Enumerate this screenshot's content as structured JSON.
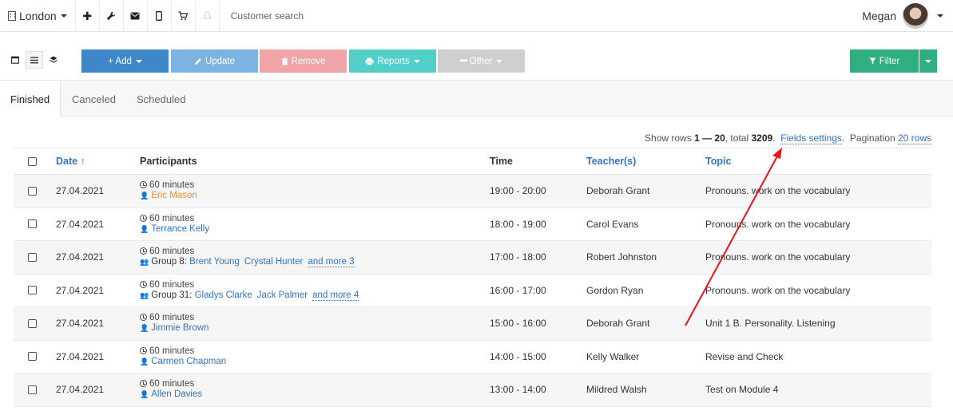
{
  "topbar": {
    "branch": "London",
    "search_placeholder": "Customer search",
    "user_name": "Megan",
    "icons": [
      "plus-icon",
      "wrench-icon",
      "envelope-icon",
      "mobile-icon",
      "cart-icon",
      "bell-icon"
    ]
  },
  "toolbar": {
    "add": "+ Add",
    "update": "Update",
    "remove": "Remove",
    "reports": "Reports",
    "other": "Other",
    "filter": "Filter"
  },
  "tabs": [
    "Finished",
    "Canceled",
    "Scheduled"
  ],
  "pagination": {
    "prefix": "Show rows",
    "range": "1 — 20",
    "total_label": ", total",
    "total": "3209",
    "fields_settings": "Fields settings",
    "pagination_label": "Pagination",
    "rows": "20 rows"
  },
  "table": {
    "headers": {
      "date": "Date ↑",
      "participants": "Participants",
      "time": "Time",
      "teachers": "Teacher(s)",
      "topic": "Topic"
    },
    "rows": [
      {
        "date": "27.04.2021",
        "duration": "60 minutes",
        "type": "single",
        "people": [
          "Eric Mason"
        ],
        "orange": true,
        "group": "",
        "more": "",
        "time": "19:00 - 20:00",
        "teacher": "Deborah Grant",
        "topic": "Pronouns. work on the vocabulary"
      },
      {
        "date": "27.04.2021",
        "duration": "60 minutes",
        "type": "single",
        "people": [
          "Terrance Kelly"
        ],
        "orange": false,
        "group": "",
        "more": "",
        "time": "18:00 - 19:00",
        "teacher": "Carol Evans",
        "topic": "Pronouns. work on the vocabulary"
      },
      {
        "date": "27.04.2021",
        "duration": "60 minutes",
        "type": "group",
        "people": [
          "Brent Young",
          "Crystal Hunter"
        ],
        "orange": false,
        "group": "Group 8:",
        "more": "and more 3",
        "time": "17:00 - 18:00",
        "teacher": "Robert Johnston",
        "topic": "Pronouns. work on the vocabulary"
      },
      {
        "date": "27.04.2021",
        "duration": "60 minutes",
        "type": "group",
        "people": [
          "Gladys Clarke",
          "Jack Palmer"
        ],
        "orange": false,
        "group": "Group 31:",
        "more": "and more 4",
        "time": "16:00 - 17:00",
        "teacher": "Gordon Ryan",
        "topic": "Pronouns. work on the vocabulary"
      },
      {
        "date": "27.04.2021",
        "duration": "60 minutes",
        "type": "single",
        "people": [
          "Jimmie Brown"
        ],
        "orange": false,
        "group": "",
        "more": "",
        "time": "15:00 - 16:00",
        "teacher": "Deborah Grant",
        "topic": "Unit 1 B. Personality. Listening"
      },
      {
        "date": "27.04.2021",
        "duration": "60 minutes",
        "type": "single",
        "people": [
          "Carmen Chapman"
        ],
        "orange": false,
        "group": "",
        "more": "",
        "time": "14:00 - 15:00",
        "teacher": "Kelly Walker",
        "topic": "Revise and Check"
      },
      {
        "date": "27.04.2021",
        "duration": "60 minutes",
        "type": "single",
        "people": [
          "Allen Davies"
        ],
        "orange": false,
        "group": "",
        "more": "",
        "time": "13:00 - 14:00",
        "teacher": "Mildred Walsh",
        "topic": "Test on Module 4"
      }
    ]
  },
  "annotation_color": "#e8141d"
}
